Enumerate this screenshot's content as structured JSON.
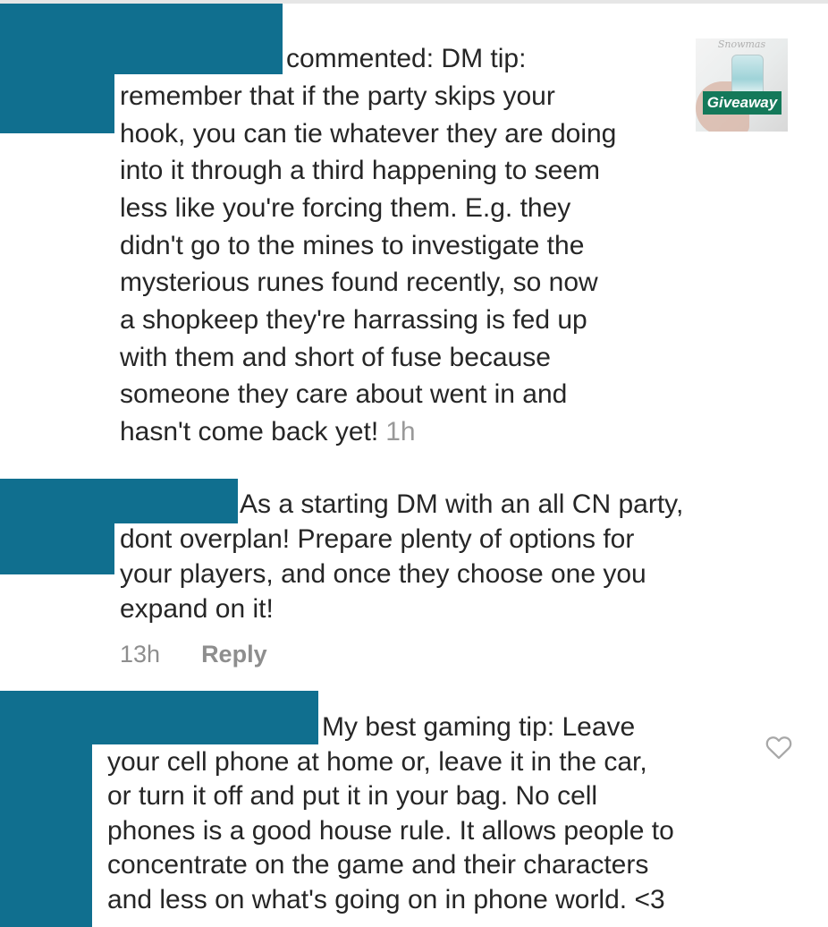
{
  "comments": [
    {
      "lines": [
        "commented: DM tip:",
        "remember that if the party skips your",
        "hook, you can tie whatever they are doing",
        "into it through a third happening to seem",
        "less like you're forcing them. E.g. they",
        "didn't go to the mines to investigate the",
        "mysterious runes found recently, so now",
        "a shopkeep they're harrassing is fed up",
        "with them and short of fuse because",
        "someone they care about went in and",
        "hasn't come back yet!"
      ],
      "time": "1h",
      "thumbnail": {
        "brand": "Snowmas",
        "tag": "Giveaway"
      }
    },
    {
      "lines": [
        "As a starting DM with an all CN party,",
        "dont overplan! Prepare plenty of options for",
        "your players, and once they choose one you",
        "expand on it!"
      ],
      "time": "13h",
      "reply_label": "Reply"
    },
    {
      "lines": [
        "My best gaming tip: Leave",
        "your cell phone at home or, leave it in the car,",
        "or turn it off and put it in your bag. No cell",
        "phones is a good house rule. It allows people to",
        "concentrate on the game and their characters",
        "and less on what's going on in phone world. <3"
      ],
      "like_icon": "heart-outline-icon"
    }
  ],
  "colors": {
    "redaction": "#106f8f",
    "text": "#262626",
    "muted": "#999999",
    "tag": "#14795a"
  }
}
